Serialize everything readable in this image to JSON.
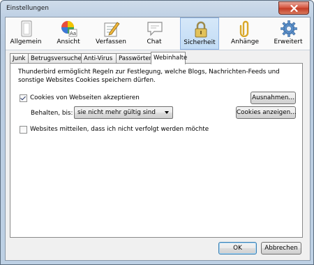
{
  "window": {
    "title": "Einstellungen"
  },
  "toolbar": {
    "items": [
      {
        "label": "Allgemein",
        "icon": "switch-icon"
      },
      {
        "label": "Ansicht",
        "icon": "color-palette-icon"
      },
      {
        "label": "Verfassen",
        "icon": "compose-icon"
      },
      {
        "label": "Chat",
        "icon": "chat-bubble-icon"
      },
      {
        "label": "Sicherheit",
        "icon": "padlock-icon",
        "selected": true
      },
      {
        "label": "Anhänge",
        "icon": "paperclip-icon"
      },
      {
        "label": "Erweitert",
        "icon": "gear-icon"
      }
    ]
  },
  "tabs": [
    {
      "label": "Junk"
    },
    {
      "label": "Betrugsversuche"
    },
    {
      "label": "Anti-Virus"
    },
    {
      "label": "Passwörter"
    },
    {
      "label": "Webinhalte",
      "active": true
    }
  ],
  "webinhalte": {
    "description": "Thunderbird ermöglicht Regeln zur Festlegung, welche Blogs, Nachrichten-Feeds und sonstige Websites Cookies speichern dürfen.",
    "accept_cookies_label": "Cookies von Webseiten akzeptieren",
    "accept_cookies_checked": true,
    "exceptions_button": "Ausnahmen...",
    "keep_label": "Behalten, bis:",
    "keep_value": "sie nicht mehr gültig sind",
    "show_cookies_button": "Cookies anzeigen...",
    "dnt_label": "Websites mitteilen, dass ich nicht verfolgt werden möchte",
    "dnt_checked": false
  },
  "footer": {
    "ok": "OK",
    "cancel": "Abbrechen"
  },
  "colors": {
    "selected_tab_bg": "#c9e0f7",
    "titlebar": "#bed0e4",
    "close": "#c9452e"
  }
}
